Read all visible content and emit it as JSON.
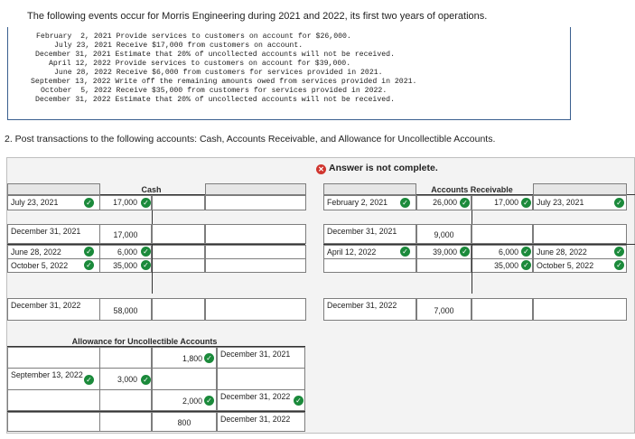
{
  "intro": "The following events occur for Morris Engineering during 2021 and 2022, its first two years of operations.",
  "events": [
    "February  2, 2021 Provide services to customers on account for $26,000.",
    "July 23, 2021 Receive $17,000 from customers on account.",
    "December 31, 2021 Estimate that 20% of uncollected accounts will not be received.",
    "April 12, 2022 Provide services to customers on account for $39,000.",
    "June 28, 2022 Receive $6,000 from customers for services provided in 2021.",
    "September 13, 2022 Write off the remaining amounts owed from services provided in 2021.",
    "October  5, 2022 Receive $35,000 from customers for services provided in 2022.",
    "December 31, 2022 Estimate that 20% of uncollected accounts will not be received."
  ],
  "question": "2. Post transactions to the following accounts: Cash, Accounts Receivable, and Allowance for Uncollectible Accounts.",
  "answer_status": "Answer is not complete.",
  "cash": {
    "title": "Cash",
    "rows": [
      {
        "label": "July 23, 2021",
        "debit": "17,000",
        "check_label": true,
        "check_val": true
      },
      {
        "label": "December 31, 2021",
        "debit": "17,000",
        "check_label": false,
        "check_val": false
      },
      {
        "label": "June 28, 2022",
        "debit": "6,000",
        "check_label": true,
        "check_val": true
      },
      {
        "label": "October 5, 2022",
        "debit": "35,000",
        "check_label": true,
        "check_val": true
      },
      {
        "label": "December 31, 2022",
        "debit": "58,000",
        "check_label": false,
        "check_val": false
      }
    ]
  },
  "ar": {
    "title": "Accounts Receivable",
    "left": [
      {
        "label": "February 2, 2021",
        "value": "26,000"
      },
      {
        "label": "December 31, 2021",
        "value": "9,000"
      },
      {
        "label": "April 12, 2022",
        "value": "39,000"
      },
      {
        "label": "December 31, 2022",
        "value": "7,000"
      }
    ],
    "right": [
      {
        "label": "July 23, 2021",
        "value": "17,000"
      },
      {
        "label": "June 28, 2022",
        "value": "6,000"
      },
      {
        "label": "October 5, 2022",
        "value": "35,000"
      }
    ]
  },
  "allowance": {
    "title": "Allowance for Uncollectible Accounts",
    "left": [
      {
        "label": "September 13, 2022",
        "value": "3,000"
      }
    ],
    "right": [
      {
        "label": "December 31, 2021",
        "value": "1,800"
      },
      {
        "label": "December 31, 2022",
        "value": "2,000"
      },
      {
        "label": "December 31, 2022",
        "value": "800"
      }
    ]
  }
}
